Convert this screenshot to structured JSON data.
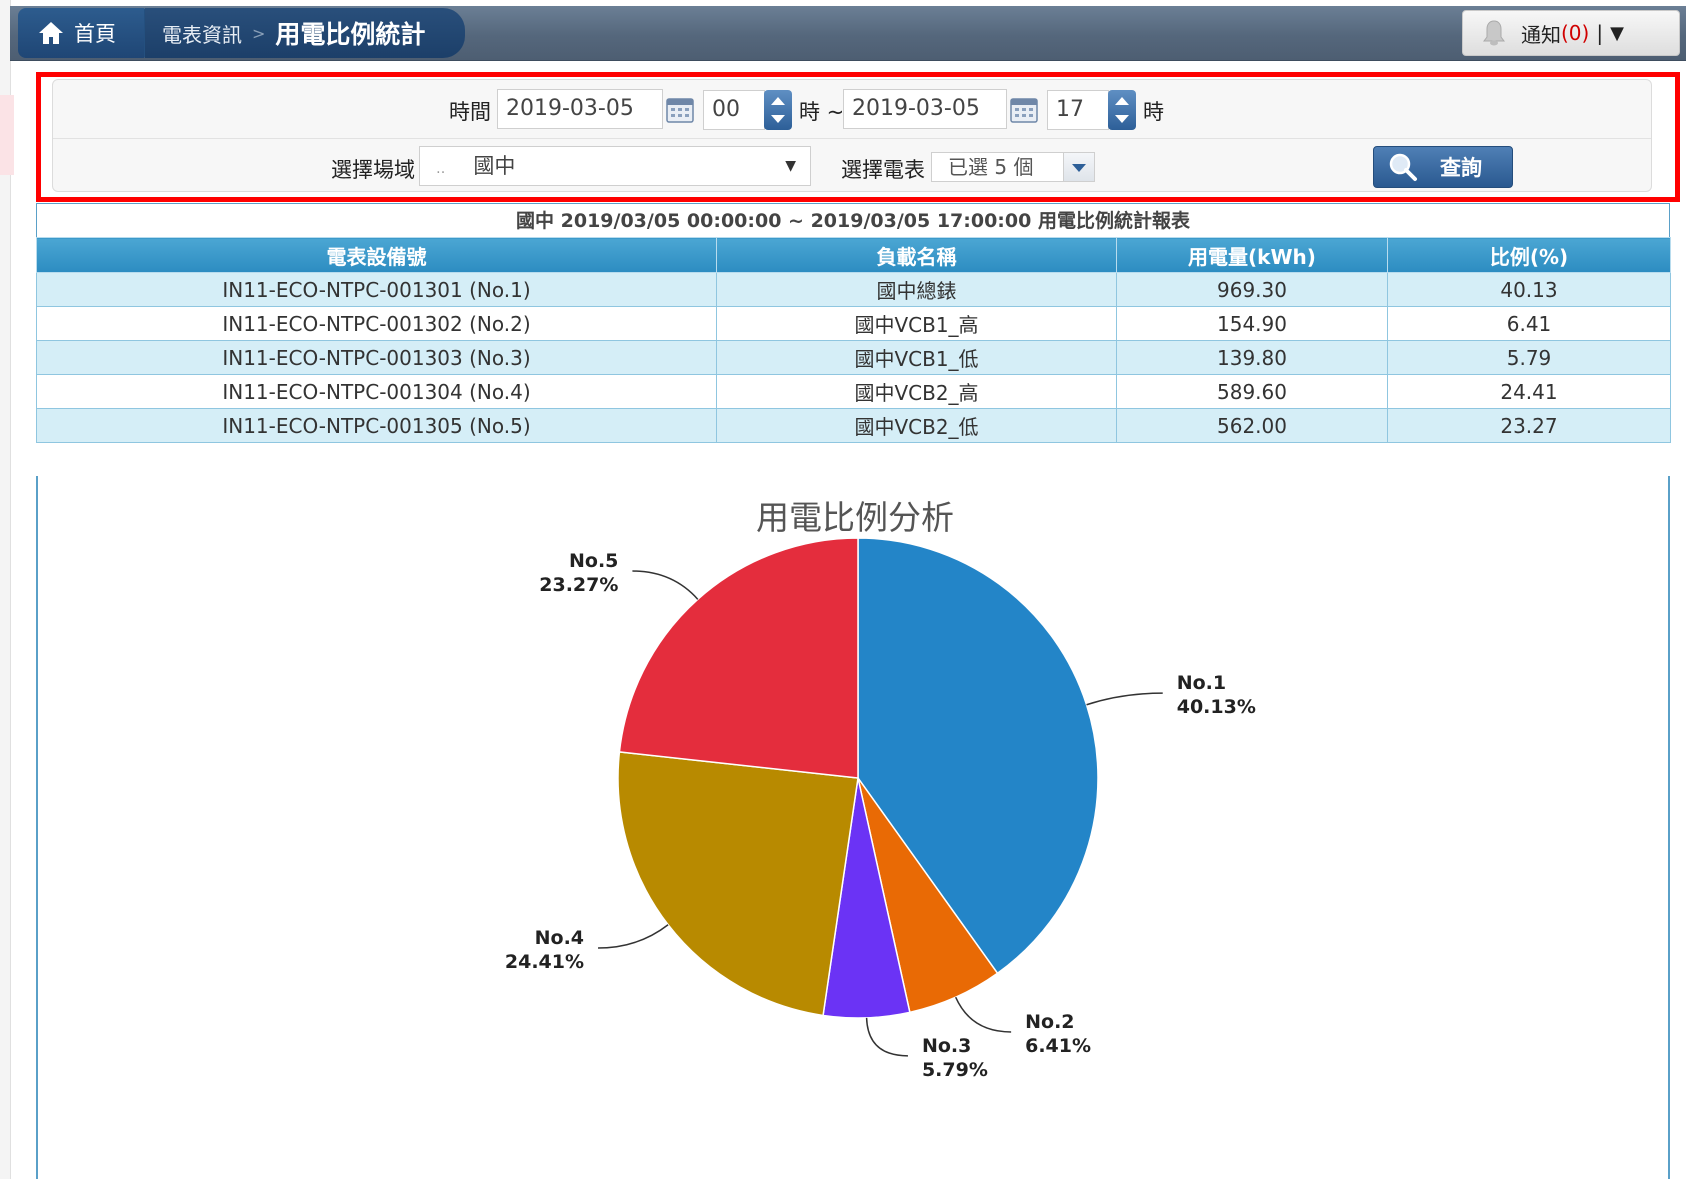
{
  "header": {
    "home_label": "首頁",
    "crumb_parent": "電表資訊",
    "crumb_separator": ">",
    "page_title": "用電比例統計",
    "notify_label": "通知",
    "notify_count_text": "(0)",
    "notify_separator": "|",
    "notify_caret": "▼"
  },
  "filters": {
    "time_label": "時間",
    "start_date": "2019-03-05",
    "start_hour": "00",
    "hour_unit_1": "時 ~",
    "end_date": "2019-03-05",
    "end_hour": "17",
    "hour_unit_2": "時",
    "site_label": "選擇場域",
    "site_dots": "‥",
    "site_value": "國中",
    "site_caret": "▼",
    "meter_label": "選擇電表",
    "meter_value": "已選 5 個",
    "query_label": "查詢"
  },
  "report": {
    "title": "國中 2019/03/05 00:00:00 ~ 2019/03/05 17:00:00 用電比例統計報表",
    "columns": [
      "電表設備號",
      "負載名稱",
      "用電量(kWh)",
      "比例(%)"
    ],
    "rows": [
      [
        "IN11-ECO-NTPC-001301 (No.1)",
        "國中總錶",
        "969.30",
        "40.13"
      ],
      [
        "IN11-ECO-NTPC-001302 (No.2)",
        "國中VCB1_高",
        "154.90",
        "6.41"
      ],
      [
        "IN11-ECO-NTPC-001303 (No.3)",
        "國中VCB1_低",
        "139.80",
        "5.79"
      ],
      [
        "IN11-ECO-NTPC-001304 (No.4)",
        "國中VCB2_高",
        "589.60",
        "24.41"
      ],
      [
        "IN11-ECO-NTPC-001305 (No.5)",
        "國中VCB2_低",
        "562.00",
        "23.27"
      ]
    ]
  },
  "chart_data": {
    "type": "pie",
    "title": "用電比例分析",
    "categories": [
      "No.1",
      "No.2",
      "No.3",
      "No.4",
      "No.5"
    ],
    "values": [
      40.13,
      6.41,
      5.79,
      24.41,
      23.27
    ],
    "labels": [
      "40.13%",
      "6.41%",
      "5.79%",
      "24.41%",
      "23.27%"
    ],
    "colors": [
      "#2385c8",
      "#e96a05",
      "#6b33f5",
      "#b88a00",
      "#e42d3d"
    ]
  },
  "colors": {
    "accent": "#2c8cc1",
    "header_bar": "#55677c",
    "highlight_border": "#ff0000",
    "row_alt": "#d5eef7"
  },
  "icons": {
    "home": "home-icon",
    "bell": "bell-icon",
    "calendar": "calendar-icon",
    "search": "search-icon"
  }
}
